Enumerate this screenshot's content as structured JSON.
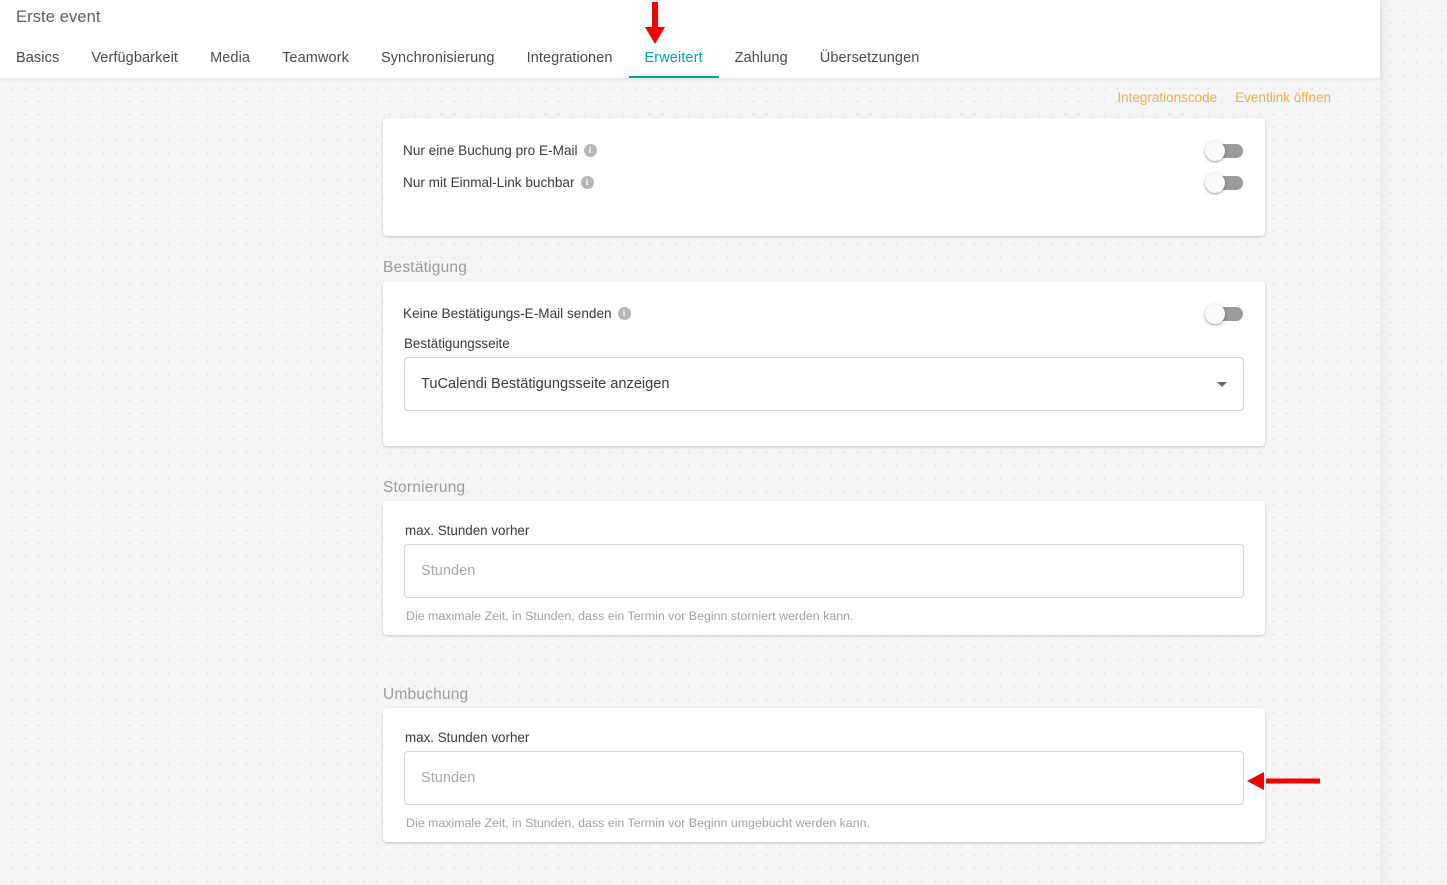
{
  "header": {
    "title": "Erste event",
    "tabs": [
      {
        "label": "Basics",
        "active": false
      },
      {
        "label": "Verfügbarkeit",
        "active": false
      },
      {
        "label": "Media",
        "active": false
      },
      {
        "label": "Teamwork",
        "active": false
      },
      {
        "label": "Synchronisierung",
        "active": false
      },
      {
        "label": "Integrationen",
        "active": false
      },
      {
        "label": "Erweitert",
        "active": true
      },
      {
        "label": "Zahlung",
        "active": false
      },
      {
        "label": "Übersetzungen",
        "active": false
      }
    ]
  },
  "toplinks": {
    "integration_code": "Integrationscode",
    "open_eventlink": "Eventlink öffnen"
  },
  "options_card": {
    "rows": [
      {
        "label": "Nur eine Buchung pro E-Mail",
        "info": "i",
        "toggle_on": false
      },
      {
        "label": "Nur mit Einmal-Link buchbar",
        "info": "i",
        "toggle_on": false
      }
    ]
  },
  "confirmation": {
    "section_label": "Bestätigung",
    "no_email_label": "Keine Bestätigungs-E-Mail senden",
    "no_email_info": "i",
    "no_email_toggle_on": false,
    "page_field_label": "Bestätigungsseite",
    "page_selected": "TuCalendi Bestätigungsseite anzeigen"
  },
  "cancellation": {
    "section_label": "Stornierung",
    "field_label": "max. Stunden vorher",
    "input_value": "",
    "input_placeholder": "Stunden",
    "hint": "Die maximale Zeit, in Stunden, dass ein Termin vor Beginn storniert werden kann."
  },
  "rebooking": {
    "section_label": "Umbuchung",
    "field_label": "max. Stunden vorher",
    "input_value": "",
    "input_placeholder": "Stunden",
    "hint": "Die maximale Zeit, in Stunden, dass ein Termin vor Beginn umgebucht werden kann."
  },
  "annotations": {
    "arrow_color": "#f50000",
    "arrow_down_target": "Erweitert",
    "arrow_left_target": "Umbuchung max. Stunden vorher Eingabefeld"
  },
  "colors": {
    "accent_teal": "#00a99d",
    "link_orange": "#f0ad4e",
    "page_bg": "#f5f5f5",
    "card_bg": "#ffffff"
  }
}
